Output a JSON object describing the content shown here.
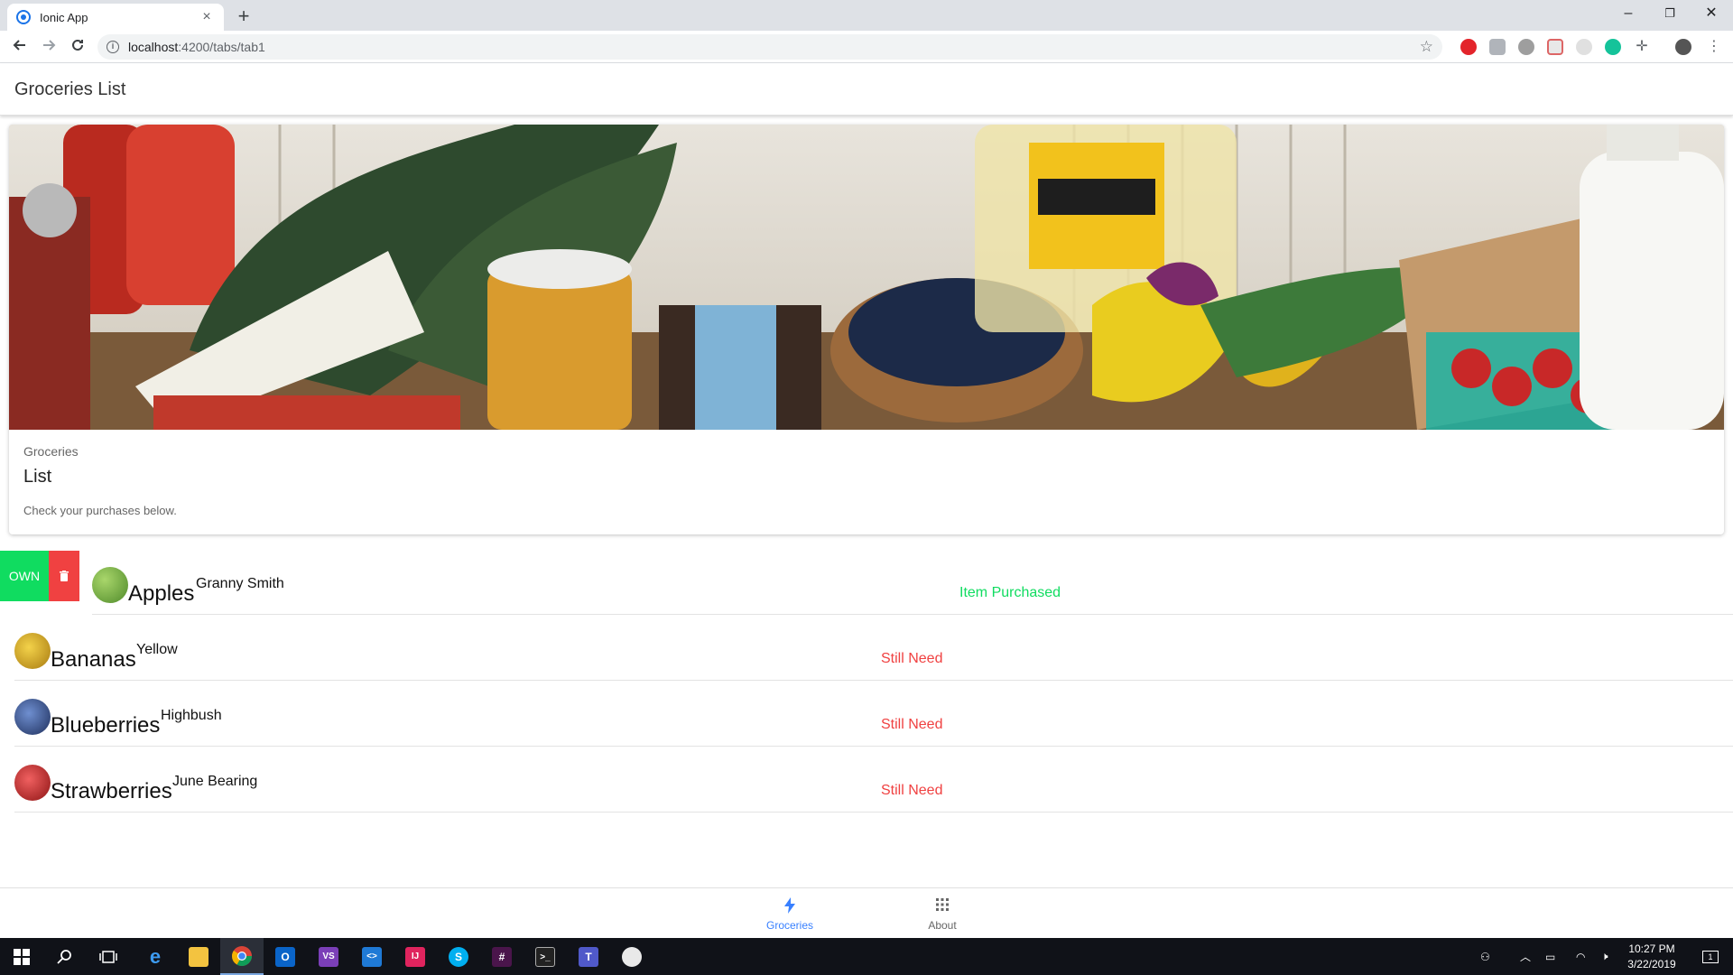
{
  "browser": {
    "tab_title": "Ionic App",
    "tab_close": "×",
    "new_tab": "+",
    "url_host": "localhost",
    "url_path": ":4200/tabs/tab1",
    "window_controls": {
      "minimize": "–",
      "restore": "❐",
      "close": "✕"
    }
  },
  "app": {
    "header_title": "Groceries List",
    "card": {
      "subtitle": "Groceries",
      "title": "List",
      "content": "Check your purchases below."
    },
    "sliding_options": {
      "own_label": "OWN",
      "delete_icon": "trash-icon"
    },
    "items": [
      {
        "name": "Apples",
        "variety": "Granny Smith",
        "status": "Item Purchased",
        "purchased": true,
        "color": "#6aa83a"
      },
      {
        "name": "Bananas",
        "variety": "Yellow",
        "status": "Still Need",
        "purchased": false,
        "color": "#d9a81c"
      },
      {
        "name": "Blueberries",
        "variety": "Highbush",
        "status": "Still Need",
        "purchased": false,
        "color": "#3b5890"
      },
      {
        "name": "Strawberries",
        "variety": "June Bearing",
        "status": "Still Need",
        "purchased": false,
        "color": "#c62c2c"
      }
    ],
    "tabs": [
      {
        "label": "Groceries",
        "icon": "flash-icon",
        "selected": true
      },
      {
        "label": "About",
        "icon": "apps-icon",
        "selected": false
      }
    ],
    "colors": {
      "success": "#10dc60",
      "danger": "#f04141",
      "primary": "#3880ff"
    }
  },
  "taskbar": {
    "time": "10:27 PM",
    "date": "3/22/2019",
    "notification_count": "1",
    "apps": [
      {
        "name": "edge",
        "label": "e",
        "color": "#1e88e5"
      },
      {
        "name": "file-explorer",
        "label": "",
        "color": "#f3c340"
      },
      {
        "name": "chrome",
        "label": "",
        "color": "#4caf50"
      },
      {
        "name": "outlook",
        "label": "O",
        "color": "#0a64c8"
      },
      {
        "name": "visual-studio",
        "label": "VS",
        "color": "#7b3fb8"
      },
      {
        "name": "vscode",
        "label": "<>",
        "color": "#1f7ad6"
      },
      {
        "name": "jetbrains",
        "label": "IJ",
        "color": "#e0245e"
      },
      {
        "name": "skype",
        "label": "S",
        "color": "#00aff0"
      },
      {
        "name": "slack",
        "label": "#",
        "color": "#4a154b"
      },
      {
        "name": "terminal",
        "label": ">_",
        "color": "#222"
      },
      {
        "name": "teams",
        "label": "T",
        "color": "#5059c9"
      },
      {
        "name": "paint",
        "label": "",
        "color": "#e9e9e9"
      }
    ]
  }
}
